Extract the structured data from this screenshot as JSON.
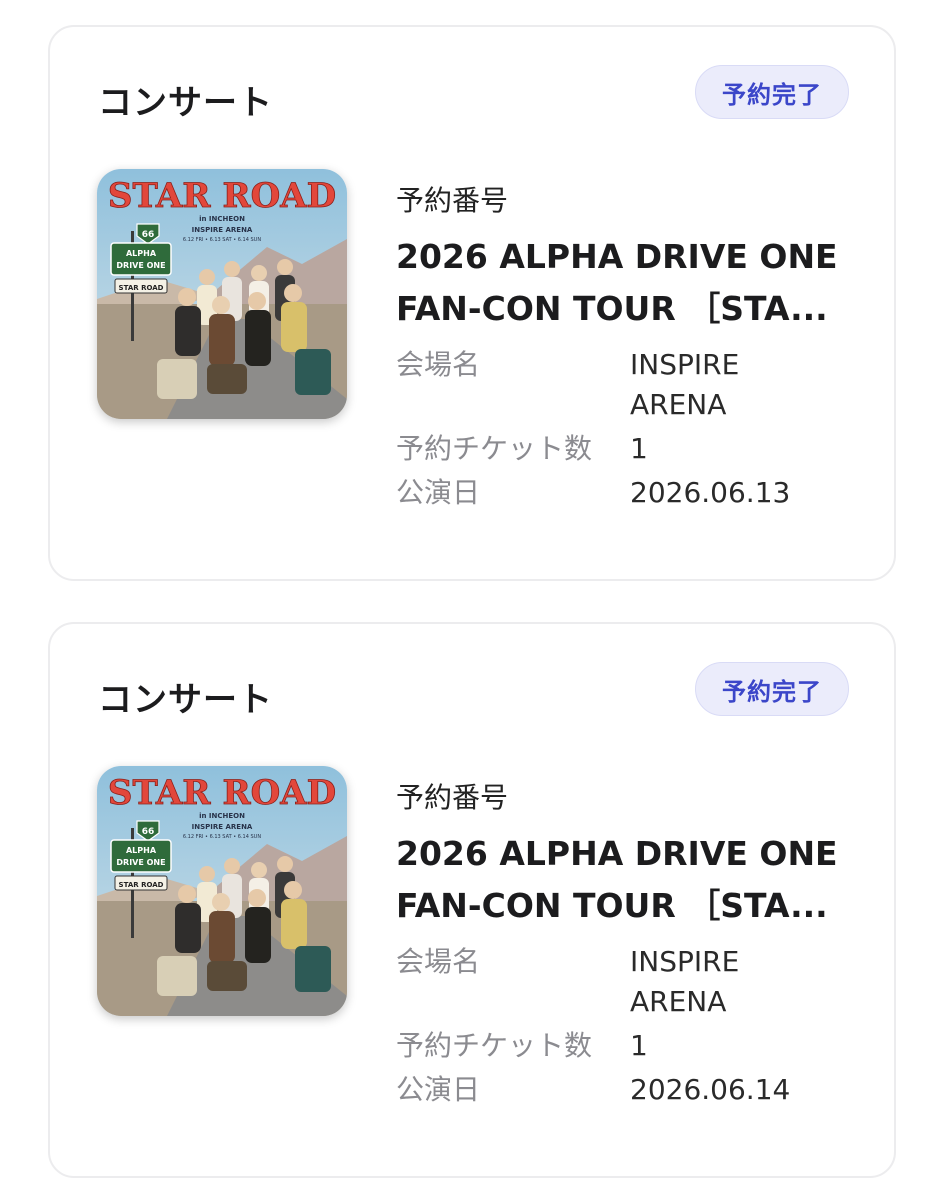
{
  "bookings": [
    {
      "category": "コンサート",
      "status": "予約完了",
      "booking_number_label": "予約番号",
      "title_line1": "2026 ALPHA DRIVE ONE",
      "title_line2": "FAN-CON TOUR ［STA...",
      "venue_label": "会場名",
      "venue_value": "INSPIRE ARENA",
      "tickets_label": "予約チケット数",
      "tickets_value": "1",
      "date_label": "公演日",
      "date_value": "2026.06.13",
      "poster": {
        "headline": "STAR ROAD",
        "sub": "in INCHEON",
        "venue": "INSPIRE ARENA",
        "dates": "6.12 FRI • 6.13 SAT • 6.14 SUN",
        "sign_number": "66",
        "sign_text1": "ALPHA",
        "sign_text2": "DRIVE ONE",
        "sign_text3": "STAR ROAD"
      }
    },
    {
      "category": "コンサート",
      "status": "予約完了",
      "booking_number_label": "予約番号",
      "title_line1": "2026 ALPHA DRIVE ONE",
      "title_line2": "FAN-CON TOUR ［STA...",
      "venue_label": "会場名",
      "venue_value": "INSPIRE ARENA",
      "tickets_label": "予約チケット数",
      "tickets_value": "1",
      "date_label": "公演日",
      "date_value": "2026.06.14",
      "poster": {
        "headline": "STAR ROAD",
        "sub": "in INCHEON",
        "venue": "INSPIRE ARENA",
        "dates": "6.12 FRI • 6.13 SAT • 6.14 SUN",
        "sign_number": "66",
        "sign_text1": "ALPHA",
        "sign_text2": "DRIVE ONE",
        "sign_text3": "STAR ROAD"
      }
    }
  ],
  "colors": {
    "badge_bg": "#ebecfb",
    "badge_text": "#3b46c9",
    "label_gray": "#8b8b90",
    "card_border": "#ececee"
  }
}
